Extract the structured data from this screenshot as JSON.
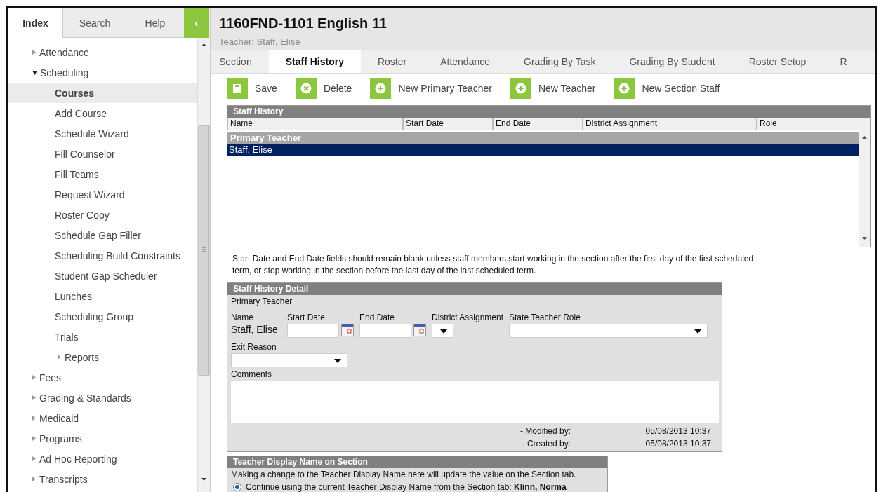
{
  "sidebar": {
    "tabs": [
      {
        "label": "Index",
        "selected": true
      },
      {
        "label": "Search",
        "selected": false
      },
      {
        "label": "Help",
        "selected": false
      }
    ],
    "collapse_button": "‹",
    "tree": [
      {
        "label": "Attendance",
        "expanded": false,
        "selected": false
      },
      {
        "label": "Scheduling",
        "expanded": true,
        "selected": false,
        "children": [
          {
            "label": "Courses",
            "selected": true
          },
          {
            "label": "Add Course",
            "selected": false
          },
          {
            "label": "Schedule Wizard",
            "selected": false
          },
          {
            "label": "Fill Counselor",
            "selected": false
          },
          {
            "label": "Fill Teams",
            "selected": false
          },
          {
            "label": "Request Wizard",
            "selected": false
          },
          {
            "label": "Roster Copy",
            "selected": false
          },
          {
            "label": "Schedule Gap Filler",
            "selected": false
          },
          {
            "label": "Scheduling Build Constraints",
            "selected": false
          },
          {
            "label": "Student Gap Scheduler",
            "selected": false
          },
          {
            "label": "Lunches",
            "selected": false
          },
          {
            "label": "Scheduling Group",
            "selected": false
          },
          {
            "label": "Trials",
            "selected": false
          },
          {
            "label": "Reports",
            "expanded": false,
            "selected": false
          }
        ]
      },
      {
        "label": "Fees",
        "expanded": false,
        "selected": false
      },
      {
        "label": "Grading & Standards",
        "expanded": false,
        "selected": false
      },
      {
        "label": "Medicaid",
        "expanded": false,
        "selected": false
      },
      {
        "label": "Programs",
        "expanded": false,
        "selected": false
      },
      {
        "label": "Ad Hoc Reporting",
        "expanded": false,
        "selected": false
      },
      {
        "label": "Transcripts",
        "expanded": false,
        "selected": false
      }
    ]
  },
  "header": {
    "title": "1160FND-1101 English 11",
    "subtitle": "Teacher: Staff, Elise"
  },
  "tabs": [
    {
      "label": "Section",
      "selected": false
    },
    {
      "label": "Staff History",
      "selected": true
    },
    {
      "label": "Roster",
      "selected": false
    },
    {
      "label": "Attendance",
      "selected": false
    },
    {
      "label": "Grading By Task",
      "selected": false
    },
    {
      "label": "Grading By Student",
      "selected": false
    },
    {
      "label": "Roster Setup",
      "selected": false
    },
    {
      "label": "R",
      "selected": false
    }
  ],
  "toolbar": [
    {
      "label": "Save",
      "kind": "save"
    },
    {
      "label": "Delete",
      "kind": "delete"
    },
    {
      "label": "New Primary Teacher",
      "kind": "add"
    },
    {
      "label": "New Teacher",
      "kind": "add"
    },
    {
      "label": "New Section Staff",
      "kind": "add"
    }
  ],
  "staff_history": {
    "title": "Staff History",
    "columns": [
      "Name",
      "Start Date",
      "End Date",
      "District Assignment",
      "Role"
    ],
    "groups": [
      {
        "label": "Primary Teacher",
        "rows": [
          {
            "name": "Staff, Elise",
            "selected": true
          }
        ]
      }
    ]
  },
  "note": "Start Date and End Date fields should remain blank unless staff members start working in the section after the first day of the first scheduled term, or stop working in the section before the last day of the last scheduled term.",
  "detail": {
    "title": "Staff History Detail",
    "subtitle": "Primary Teacher",
    "name_label": "Name",
    "name_value": "Staff, Elise",
    "start_date_label": "Start Date",
    "end_date_label": "End Date",
    "district_assignment_label": "District Assignment",
    "state_teacher_role_label": "State Teacher Role",
    "exit_reason_label": "Exit Reason",
    "comments_label": "Comments",
    "modified_label": "- Modified by:",
    "modified_value": "05/08/2013 10:37",
    "created_label": "- Created by:",
    "created_value": "05/08/2013 10:37"
  },
  "display_name": {
    "title": "Teacher Display Name on Section",
    "text": "Making a change to the Teacher Display Name here will update the value on the Section tab.",
    "option": {
      "label": "Continue using the current Teacher Display Name from the Section tab: **Klinn, Norma**",
      "selected": true
    }
  }
}
